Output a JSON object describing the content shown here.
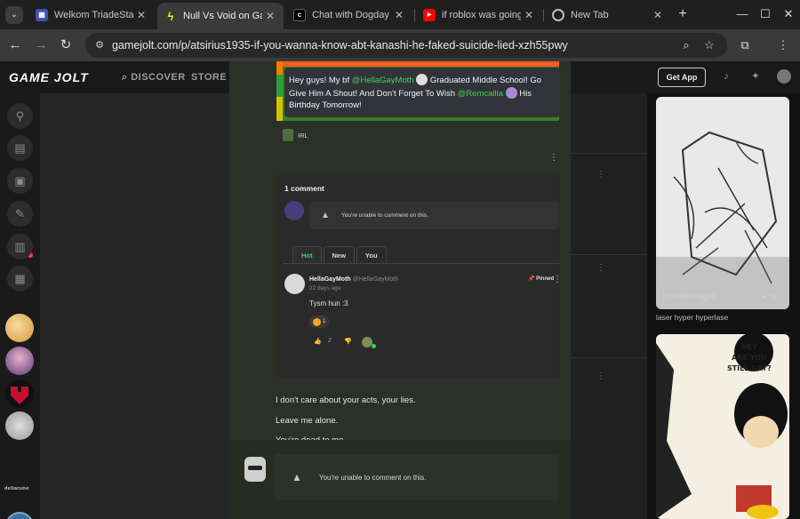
{
  "browser": {
    "tabs": [
      {
        "title": "Welkom TriadeStart",
        "favicon": "triade-icon"
      },
      {
        "title": "Null Vs Void on Game Jolt",
        "favicon": "gamejolt-icon"
      },
      {
        "title": "Chat with Dogday | c.ai",
        "favicon": "cai-icon"
      },
      {
        "title": "if roblox was going to",
        "favicon": "youtube-icon"
      },
      {
        "title": "New Tab",
        "favicon": "chrome-icon"
      }
    ],
    "url": "gamejolt.com/p/atsirius1935-if-you-wanna-know-abt-kanashi-he-faked-suicide-lied-xzh55pwy"
  },
  "gamejolt": {
    "logo": "GAME JOLT",
    "nav": [
      "DISCOVER",
      "STORE"
    ],
    "get_app": "Get App",
    "sidebar_label": "deltarune"
  },
  "post": {
    "bubble_parts": {
      "t1": "Hey guys! My bf ",
      "m1": "@HellaGayMoth",
      "t2": " Graduated Middle School! Go Give Him A Shout! And Don't Forget To Wish ",
      "m2": "@Remcallia",
      "t3": " His Birthday Tomorrow!"
    },
    "tag_label": "IRL",
    "lines": [
      "I don't care about your acts, your lies.",
      "Leave me alone.",
      "You're dead to me."
    ]
  },
  "comments": {
    "count_label": "1 comment",
    "unable_text": "You're unable to comment on this.",
    "tabs": [
      "Hot",
      "New",
      "You"
    ],
    "item": {
      "name": "HellaGayMoth",
      "handle": "@HellaGayMoth",
      "time": "22 days ago",
      "pinned": "Pinned",
      "text": "Tysm hun :3",
      "reaction_count": "1",
      "likes": "2"
    }
  },
  "right_panel": {
    "card1_author": "@subterfuged",
    "card1_likes": "18",
    "card1_caption": "laser hyper hyperlase",
    "card2_text": "HEY\nARE YOU\nSTILL GAY?"
  }
}
